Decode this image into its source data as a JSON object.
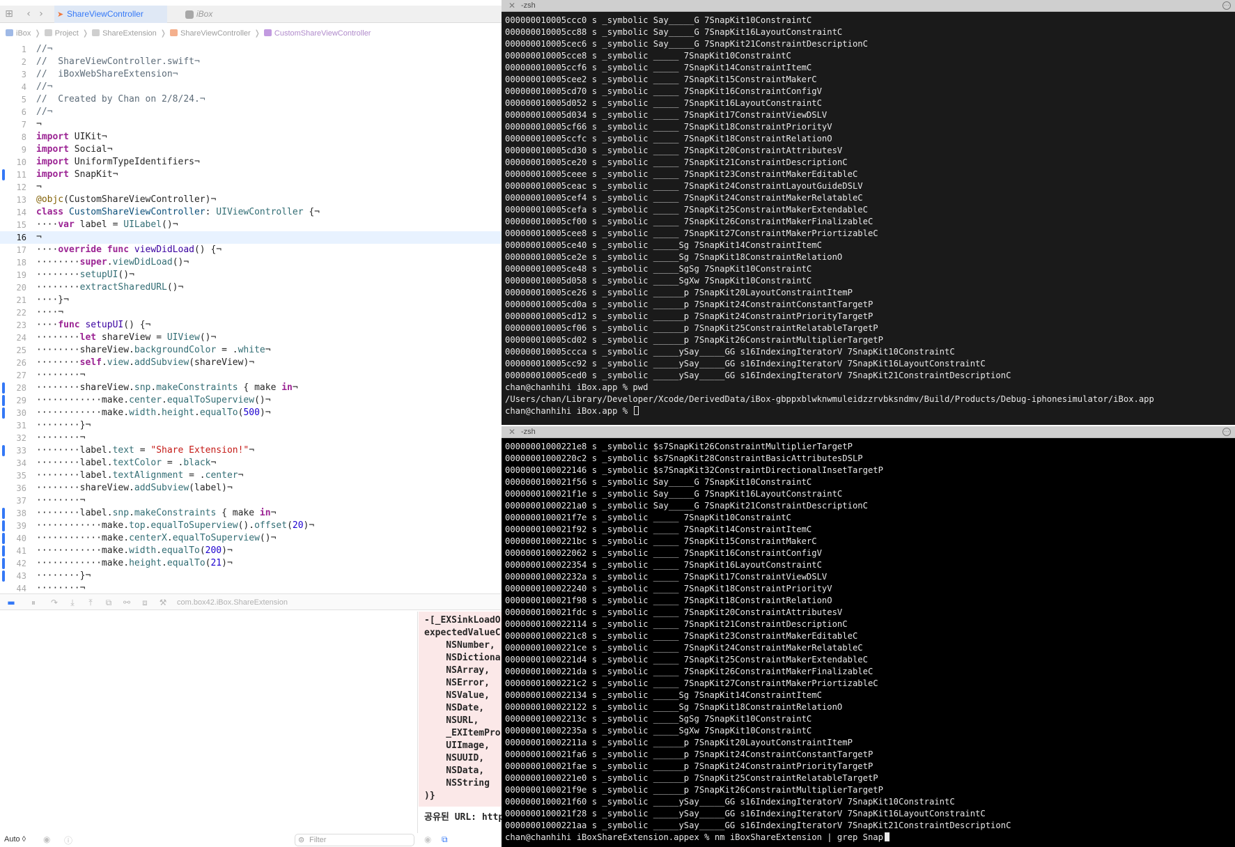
{
  "xcode": {
    "tabs": [
      {
        "label": "ShareViewController",
        "active": true
      },
      {
        "label": "iBox",
        "active": false
      }
    ],
    "breadcrumb": [
      "iBox",
      "Project",
      "ShareExtension",
      "ShareViewController",
      "CustomShareViewController"
    ],
    "current_line": 16,
    "changed_lines": [
      11,
      28,
      29,
      30,
      33,
      38,
      39,
      40,
      41,
      42,
      43
    ],
    "scheme": "com.box42.iBox.ShareExtension",
    "code_lines": [
      [
        [
          "c",
          "//¬"
        ]
      ],
      [
        [
          "c",
          "//  ShareViewController.swift¬"
        ]
      ],
      [
        [
          "c",
          "//  iBoxWebShareExtension¬"
        ]
      ],
      [
        [
          "c",
          "//¬"
        ]
      ],
      [
        [
          "c",
          "//  Created by Chan on 2/8/24.¬"
        ]
      ],
      [
        [
          "c",
          "//¬"
        ]
      ],
      [
        [
          "",
          "¬"
        ]
      ],
      [
        [
          "k",
          "import"
        ],
        [
          "",
          " UIKit¬"
        ]
      ],
      [
        [
          "k",
          "import"
        ],
        [
          "",
          " Social¬"
        ]
      ],
      [
        [
          "k",
          "import"
        ],
        [
          "",
          " UniformTypeIdentifiers¬"
        ]
      ],
      [
        [
          "k",
          "import"
        ],
        [
          "",
          " SnapKit¬"
        ]
      ],
      [
        [
          "",
          "¬"
        ]
      ],
      [
        [
          "a",
          "@objc"
        ],
        [
          "",
          "(CustomShareViewController)¬"
        ]
      ],
      [
        [
          "k",
          "class"
        ],
        [
          "",
          " "
        ],
        [
          "t",
          "CustomShareViewController"
        ],
        [
          "",
          ": "
        ],
        [
          "m",
          "UIViewController"
        ],
        [
          "",
          " {¬"
        ]
      ],
      [
        [
          "",
          "····"
        ],
        [
          "k",
          "var"
        ],
        [
          "",
          " label = "
        ],
        [
          "m",
          "UILabel"
        ],
        [
          "",
          "()¬"
        ]
      ],
      [
        [
          "",
          "¬"
        ]
      ],
      [
        [
          "",
          "····"
        ],
        [
          "k",
          "override func"
        ],
        [
          "",
          " "
        ],
        [
          "f",
          "viewDidLoad"
        ],
        [
          "",
          "() {¬"
        ]
      ],
      [
        [
          "",
          "········"
        ],
        [
          "k",
          "super"
        ],
        [
          "",
          "."
        ],
        [
          "m",
          "viewDidLoad"
        ],
        [
          "",
          "()¬"
        ]
      ],
      [
        [
          "",
          "········"
        ],
        [
          "m",
          "setupUI"
        ],
        [
          "",
          "()¬"
        ]
      ],
      [
        [
          "",
          "········"
        ],
        [
          "m",
          "extractSharedURL"
        ],
        [
          "",
          "()¬"
        ]
      ],
      [
        [
          "",
          "····}¬"
        ]
      ],
      [
        [
          "",
          "····¬"
        ]
      ],
      [
        [
          "",
          "····"
        ],
        [
          "k",
          "func"
        ],
        [
          "",
          " "
        ],
        [
          "f",
          "setupUI"
        ],
        [
          "",
          "() {¬"
        ]
      ],
      [
        [
          "",
          "········"
        ],
        [
          "k",
          "let"
        ],
        [
          "",
          " shareView = "
        ],
        [
          "m",
          "UIView"
        ],
        [
          "",
          "()¬"
        ]
      ],
      [
        [
          "",
          "········shareView."
        ],
        [
          "m",
          "backgroundColor"
        ],
        [
          "",
          " = ."
        ],
        [
          "m",
          "white"
        ],
        [
          "",
          "¬"
        ]
      ],
      [
        [
          "",
          "········"
        ],
        [
          "k",
          "self"
        ],
        [
          "",
          "."
        ],
        [
          "m",
          "view"
        ],
        [
          "",
          "."
        ],
        [
          "m",
          "addSubview"
        ],
        [
          "",
          "(shareView)¬"
        ]
      ],
      [
        [
          "",
          "········¬"
        ]
      ],
      [
        [
          "",
          "········shareView."
        ],
        [
          "m",
          "snp"
        ],
        [
          "",
          "."
        ],
        [
          "m",
          "makeConstraints"
        ],
        [
          "",
          " { make "
        ],
        [
          "k",
          "in"
        ],
        [
          "",
          "¬"
        ]
      ],
      [
        [
          "",
          "············make."
        ],
        [
          "m",
          "center"
        ],
        [
          "",
          "."
        ],
        [
          "m",
          "equalToSuperview"
        ],
        [
          "",
          "()¬"
        ]
      ],
      [
        [
          "",
          "············make."
        ],
        [
          "m",
          "width"
        ],
        [
          "",
          "."
        ],
        [
          "m",
          "height"
        ],
        [
          "",
          "."
        ],
        [
          "m",
          "equalTo"
        ],
        [
          "",
          "("
        ],
        [
          "n",
          "500"
        ],
        [
          "",
          ")¬"
        ]
      ],
      [
        [
          "",
          "········}¬"
        ]
      ],
      [
        [
          "",
          "········¬"
        ]
      ],
      [
        [
          "",
          "········label."
        ],
        [
          "m",
          "text"
        ],
        [
          "",
          " = "
        ],
        [
          "s",
          "\"Share Extension!\""
        ],
        [
          "",
          "¬"
        ]
      ],
      [
        [
          "",
          "········label."
        ],
        [
          "m",
          "textColor"
        ],
        [
          "",
          " = ."
        ],
        [
          "m",
          "black"
        ],
        [
          "",
          "¬"
        ]
      ],
      [
        [
          "",
          "········label."
        ],
        [
          "m",
          "textAlignment"
        ],
        [
          "",
          " = ."
        ],
        [
          "m",
          "center"
        ],
        [
          "",
          "¬"
        ]
      ],
      [
        [
          "",
          "········shareView."
        ],
        [
          "m",
          "addSubview"
        ],
        [
          "",
          "(label)¬"
        ]
      ],
      [
        [
          "",
          "········¬"
        ]
      ],
      [
        [
          "",
          "········label."
        ],
        [
          "m",
          "snp"
        ],
        [
          "",
          "."
        ],
        [
          "m",
          "makeConstraints"
        ],
        [
          "",
          " { make "
        ],
        [
          "k",
          "in"
        ],
        [
          "",
          "¬"
        ]
      ],
      [
        [
          "",
          "············make."
        ],
        [
          "m",
          "top"
        ],
        [
          "",
          "."
        ],
        [
          "m",
          "equalToSuperview"
        ],
        [
          "",
          "()."
        ],
        [
          "m",
          "offset"
        ],
        [
          "",
          "("
        ],
        [
          "n",
          "20"
        ],
        [
          "",
          ")¬"
        ]
      ],
      [
        [
          "",
          "············make."
        ],
        [
          "m",
          "centerX"
        ],
        [
          "",
          "."
        ],
        [
          "m",
          "equalToSuperview"
        ],
        [
          "",
          "()¬"
        ]
      ],
      [
        [
          "",
          "············make."
        ],
        [
          "m",
          "width"
        ],
        [
          "",
          "."
        ],
        [
          "m",
          "equalTo"
        ],
        [
          "",
          "("
        ],
        [
          "n",
          "200"
        ],
        [
          "",
          ")¬"
        ]
      ],
      [
        [
          "",
          "············make."
        ],
        [
          "m",
          "height"
        ],
        [
          "",
          "."
        ],
        [
          "m",
          "equalTo"
        ],
        [
          "",
          "("
        ],
        [
          "n",
          "21"
        ],
        [
          "",
          ")¬"
        ]
      ],
      [
        [
          "",
          "········}¬"
        ]
      ],
      [
        [
          "",
          "········¬"
        ]
      ]
    ],
    "console_error": "-[_EXSinkLoadO\nexpectedValueC\n    NSNumber,\n    NSDictiona\n    NSArray,\n    NSError,\n    NSValue,\n    NSDate,\n    NSURL,\n    _EXItemPro\n    UIImage,\n    NSUUID,\n    NSData,\n    NSString\n)}",
    "console_url": "공유된 URL: http",
    "auto_label": "Auto ◊",
    "filter_placeholder": "Filter"
  },
  "terminal_top": {
    "title": "-zsh",
    "lines": [
      "000000010005ccc0 s _symbolic Say_____G 7SnapKit10ConstraintC",
      "000000010005cc88 s _symbolic Say_____G 7SnapKit16LayoutConstraintC",
      "000000010005cec6 s _symbolic Say_____G 7SnapKit21ConstraintDescriptionC",
      "000000010005cce8 s _symbolic _____ 7SnapKit10ConstraintC",
      "000000010005ccf6 s _symbolic _____ 7SnapKit14ConstraintItemC",
      "000000010005cee2 s _symbolic _____ 7SnapKit15ConstraintMakerC",
      "000000010005cd70 s _symbolic _____ 7SnapKit16ConstraintConfigV",
      "000000010005d052 s _symbolic _____ 7SnapKit16LayoutConstraintC",
      "000000010005d034 s _symbolic _____ 7SnapKit17ConstraintViewDSLV",
      "000000010005cf66 s _symbolic _____ 7SnapKit18ConstraintPriorityV",
      "000000010005ccfc s _symbolic _____ 7SnapKit18ConstraintRelationO",
      "000000010005cd30 s _symbolic _____ 7SnapKit20ConstraintAttributesV",
      "000000010005ce20 s _symbolic _____ 7SnapKit21ConstraintDescriptionC",
      "000000010005ceee s _symbolic _____ 7SnapKit23ConstraintMakerEditableC",
      "000000010005ceac s _symbolic _____ 7SnapKit24ConstraintLayoutGuideDSLV",
      "000000010005cef4 s _symbolic _____ 7SnapKit24ConstraintMakerRelatableC",
      "000000010005cefa s _symbolic _____ 7SnapKit25ConstraintMakerExtendableC",
      "000000010005cf00 s _symbolic _____ 7SnapKit26ConstraintMakerFinalizableC",
      "000000010005cee8 s _symbolic _____ 7SnapKit27ConstraintMakerPriortizableC",
      "000000010005ce40 s _symbolic _____Sg 7SnapKit14ConstraintItemC",
      "000000010005ce2e s _symbolic _____Sg 7SnapKit18ConstraintRelationO",
      "000000010005ce48 s _symbolic _____SgSg 7SnapKit10ConstraintC",
      "000000010005d058 s _symbolic _____SgXw 7SnapKit10ConstraintC",
      "000000010005ce26 s _symbolic ______p 7SnapKit20LayoutConstraintItemP",
      "000000010005cd0a s _symbolic ______p 7SnapKit24ConstraintConstantTargetP",
      "000000010005cd12 s _symbolic ______p 7SnapKit24ConstraintPriorityTargetP",
      "000000010005cf06 s _symbolic ______p 7SnapKit25ConstraintRelatableTargetP",
      "000000010005cd02 s _symbolic ______p 7SnapKit26ConstraintMultiplierTargetP",
      "000000010005ccca s _symbolic _____ySay_____GG s16IndexingIteratorV 7SnapKit10ConstraintC",
      "000000010005cc92 s _symbolic _____ySay_____GG s16IndexingIteratorV 7SnapKit16LayoutConstraintC",
      "000000010005ced0 s _symbolic _____ySay_____GG s16IndexingIteratorV 7SnapKit21ConstraintDescriptionC",
      "chan@chanhihi iBox.app % pwd",
      "/Users/chan/Library/Developer/Xcode/DerivedData/iBox-gbppxblwknwmuleidzzrvbksndmv/Build/Products/Debug-iphonesimulator/iBox.app",
      "chan@chanhihi iBox.app % "
    ]
  },
  "terminal_bottom": {
    "title": "-zsh",
    "lines": [
      "00000001000221e8 s _symbolic $s7SnapKit26ConstraintMultiplierTargetP",
      "00000001000220c2 s _symbolic $s7SnapKit28ConstraintBasicAttributesDSLP",
      "0000000100022146 s _symbolic $s7SnapKit32ConstraintDirectionalInsetTargetP",
      "0000000100021f56 s _symbolic Say_____G 7SnapKit10ConstraintC",
      "0000000100021f1e s _symbolic Say_____G 7SnapKit16LayoutConstraintC",
      "00000001000221a0 s _symbolic Say_____G 7SnapKit21ConstraintDescriptionC",
      "0000000100021f7e s _symbolic _____ 7SnapKit10ConstraintC",
      "0000000100021f92 s _symbolic _____ 7SnapKit14ConstraintItemC",
      "00000001000221bc s _symbolic _____ 7SnapKit15ConstraintMakerC",
      "0000000100022062 s _symbolic _____ 7SnapKit16ConstraintConfigV",
      "0000000100022354 s _symbolic _____ 7SnapKit16LayoutConstraintC",
      "000000010002232a s _symbolic _____ 7SnapKit17ConstraintViewDSLV",
      "0000000100022240 s _symbolic _____ 7SnapKit18ConstraintPriorityV",
      "0000000100021f98 s _symbolic _____ 7SnapKit18ConstraintRelationO",
      "0000000100021fdc s _symbolic _____ 7SnapKit20ConstraintAttributesV",
      "0000000100022114 s _symbolic _____ 7SnapKit21ConstraintDescriptionC",
      "00000001000221c8 s _symbolic _____ 7SnapKit23ConstraintMakerEditableC",
      "00000001000221ce s _symbolic _____ 7SnapKit24ConstraintMakerRelatableC",
      "00000001000221d4 s _symbolic _____ 7SnapKit25ConstraintMakerExtendableC",
      "00000001000221da s _symbolic _____ 7SnapKit26ConstraintMakerFinalizableC",
      "00000001000221c2 s _symbolic _____ 7SnapKit27ConstraintMakerPriortizableC",
      "0000000100022134 s _symbolic _____Sg 7SnapKit14ConstraintItemC",
      "0000000100022122 s _symbolic _____Sg 7SnapKit18ConstraintRelationO",
      "000000010002213c s _symbolic _____SgSg 7SnapKit10ConstraintC",
      "000000010002235a s _symbolic _____SgXw 7SnapKit10ConstraintC",
      "000000010002211a s _symbolic ______p 7SnapKit20LayoutConstraintItemP",
      "0000000100021fa6 s _symbolic ______p 7SnapKit24ConstraintConstantTargetP",
      "0000000100021fae s _symbolic ______p 7SnapKit24ConstraintPriorityTargetP",
      "00000001000221e0 s _symbolic ______p 7SnapKit25ConstraintRelatableTargetP",
      "0000000100021f9e s _symbolic ______p 7SnapKit26ConstraintMultiplierTargetP",
      "0000000100021f60 s _symbolic _____ySay_____GG s16IndexingIteratorV 7SnapKit10ConstraintC",
      "0000000100021f28 s _symbolic _____ySay_____GG s16IndexingIteratorV 7SnapKit16LayoutConstraintC",
      "00000001000221aa s _symbolic _____ySay_____GG s16IndexingIteratorV 7SnapKit21ConstraintDescriptionC",
      "chan@chanhihi iBoxShareExtension.appex % nm iBoxShareExtension | grep Snap"
    ]
  }
}
